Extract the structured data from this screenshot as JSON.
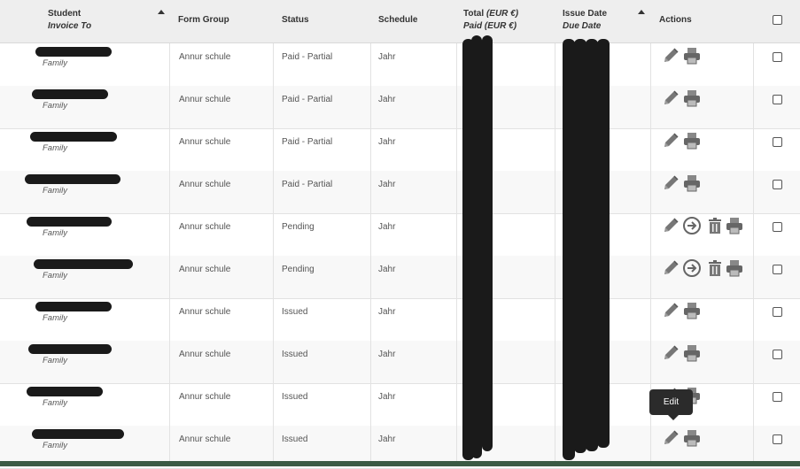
{
  "columns": {
    "student": "Student",
    "invoice_to": "Invoice To",
    "form_group": "Form Group",
    "status": "Status",
    "schedule": "Schedule",
    "total": "Total",
    "total_currency": "(EUR €)",
    "paid": "Paid",
    "paid_currency": "(EUR €)",
    "issue_date": "Issue Date",
    "due_date": "Due Date",
    "actions": "Actions"
  },
  "rows": [
    {
      "invoice_to": "Family",
      "form_group": "Annur schule",
      "status": "Paid - Partial",
      "schedule": "Jahr",
      "actions": [
        "edit",
        "print"
      ]
    },
    {
      "invoice_to": "Family",
      "form_group": "Annur schule",
      "status": "Paid - Partial",
      "schedule": "Jahr",
      "actions": [
        "edit",
        "print"
      ]
    },
    {
      "invoice_to": "Family",
      "form_group": "Annur schule",
      "status": "Paid - Partial",
      "schedule": "Jahr",
      "actions": [
        "edit",
        "print"
      ]
    },
    {
      "invoice_to": "Family",
      "form_group": "Annur schule",
      "status": "Paid - Partial",
      "schedule": "Jahr",
      "actions": [
        "edit",
        "print"
      ]
    },
    {
      "invoice_to": "Family",
      "form_group": "Annur schule",
      "status": "Pending",
      "schedule": "Jahr",
      "actions": [
        "edit",
        "issue",
        "delete",
        "print"
      ]
    },
    {
      "invoice_to": "Family",
      "form_group": "Annur schule",
      "status": "Pending",
      "schedule": "Jahr",
      "actions": [
        "edit",
        "issue",
        "delete",
        "print"
      ]
    },
    {
      "invoice_to": "Family",
      "form_group": "Annur schule",
      "status": "Issued",
      "schedule": "Jahr",
      "actions": [
        "edit",
        "print"
      ]
    },
    {
      "invoice_to": "Family",
      "form_group": "Annur schule",
      "status": "Issued",
      "schedule": "Jahr",
      "actions": [
        "edit",
        "print"
      ]
    },
    {
      "invoice_to": "Family",
      "form_group": "Annur schule",
      "status": "Issued",
      "schedule": "Jahr",
      "actions": [
        "edit",
        "print"
      ]
    },
    {
      "invoice_to": "Family",
      "form_group": "Annur schule",
      "status": "Issued",
      "schedule": "Jahr",
      "actions": [
        "edit",
        "print"
      ]
    }
  ],
  "tooltip": "Edit",
  "colors": {
    "header_bg": "#eeeeee",
    "redaction": "#1a1a1a",
    "icon": "#666666"
  }
}
